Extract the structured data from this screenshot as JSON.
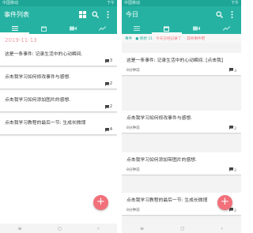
{
  "colors": {
    "primary": "#26b2a2",
    "accent": "#f2707a",
    "date": "#e8a0a6"
  },
  "left": {
    "status": {
      "left": "中国移动",
      "right": "下午"
    },
    "title": "事件列表",
    "date_header": "2019-11-13",
    "notes": [
      {
        "text": "这是一条事件: 记录生活中的心动瞬间.",
        "count": "3"
      },
      {
        "text": "点击我学习如何修改事件与感想.",
        "count": "2"
      },
      {
        "text": "点击我学习如何添加图片的感想.",
        "count": "2"
      },
      {
        "text": "点击我学习教程的最后一节: 生成长微博",
        "count": "4"
      }
    ],
    "fab": "+",
    "nav": {
      "back": "‹",
      "home": "○",
      "menu": "≡"
    }
  },
  "right": {
    "status": {
      "left": "中国移动",
      "right": "下午"
    },
    "title": "今日",
    "tags": {
      "t1": "事件",
      "t2": "● 感想 11",
      "t3": "今天已经记录了",
      "t4": "· 其他事件吧"
    },
    "cards": [
      {
        "text": "这是一条事件: 记录生活中的心动瞬间. [点击我]",
        "time": "8分钟前",
        "count": "3"
      },
      {
        "text": "点击我学习如何修改事件与感想.",
        "time": "8分钟前",
        "count": "2"
      },
      {
        "text": "点击我学习如何添加带图片的感想.",
        "time": "8分钟前",
        "count": "2"
      },
      {
        "text": "点击我学习教程的最后一节: 生成长微博",
        "time": "8分钟前",
        "count": "2"
      }
    ],
    "fab": "+",
    "nav": {
      "back": "‹",
      "home": "○",
      "menu": "≡"
    }
  }
}
